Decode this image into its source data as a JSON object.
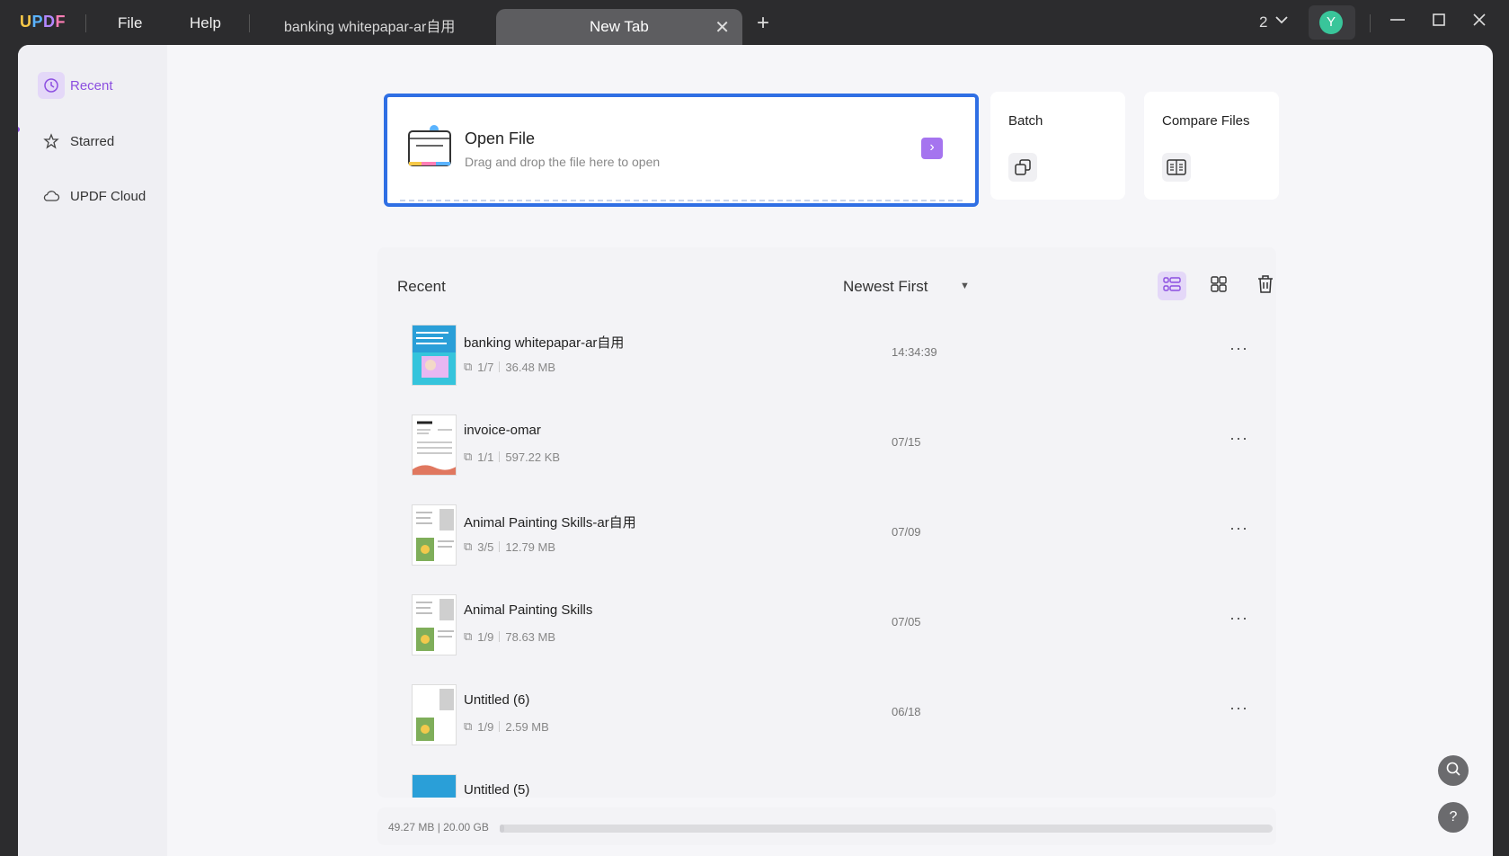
{
  "titlebar": {
    "logo": [
      "U",
      "P",
      "D",
      "F"
    ],
    "menu": {
      "file": "File",
      "help": "Help"
    },
    "tabs": {
      "inactive": "banking whitepapar-ar自用",
      "active": "New Tab"
    },
    "window_count": "2",
    "avatar_letter": "Y"
  },
  "sidebar": {
    "items": [
      {
        "label": "Recent",
        "icon": "clock-icon",
        "active": true
      },
      {
        "label": "Starred",
        "icon": "star-icon",
        "active": false
      },
      {
        "label": "UPDF Cloud",
        "icon": "cloud-icon",
        "active": false
      }
    ]
  },
  "open_file": {
    "title": "Open File",
    "subtitle": "Drag and drop the file here to open"
  },
  "cards": {
    "batch": "Batch",
    "compare": "Compare Files"
  },
  "recent_panel": {
    "title": "Recent",
    "sort": "Newest First",
    "files": [
      {
        "name": "banking whitepapar-ar自用",
        "pages": "1/7",
        "size": "36.48 MB",
        "date": "14:34:39"
      },
      {
        "name": "invoice-omar",
        "pages": "1/1",
        "size": "597.22 KB",
        "date": "07/15"
      },
      {
        "name": "Animal Painting Skills-ar自用",
        "pages": "3/5",
        "size": "12.79 MB",
        "date": "07/09"
      },
      {
        "name": "Animal Painting Skills",
        "pages": "1/9",
        "size": "78.63 MB",
        "date": "07/05"
      },
      {
        "name": "Untitled (6)",
        "pages": "1/9",
        "size": "2.59 MB",
        "date": "06/18"
      },
      {
        "name": "Untitled (5)",
        "pages": "",
        "size": "",
        "date": ""
      }
    ]
  },
  "storage": {
    "text": "49.27 MB | 20.00 GB",
    "used_fraction": 0.0024
  },
  "colors": {
    "accent": "#8c4fe0",
    "open_border": "#2f6fe4"
  }
}
